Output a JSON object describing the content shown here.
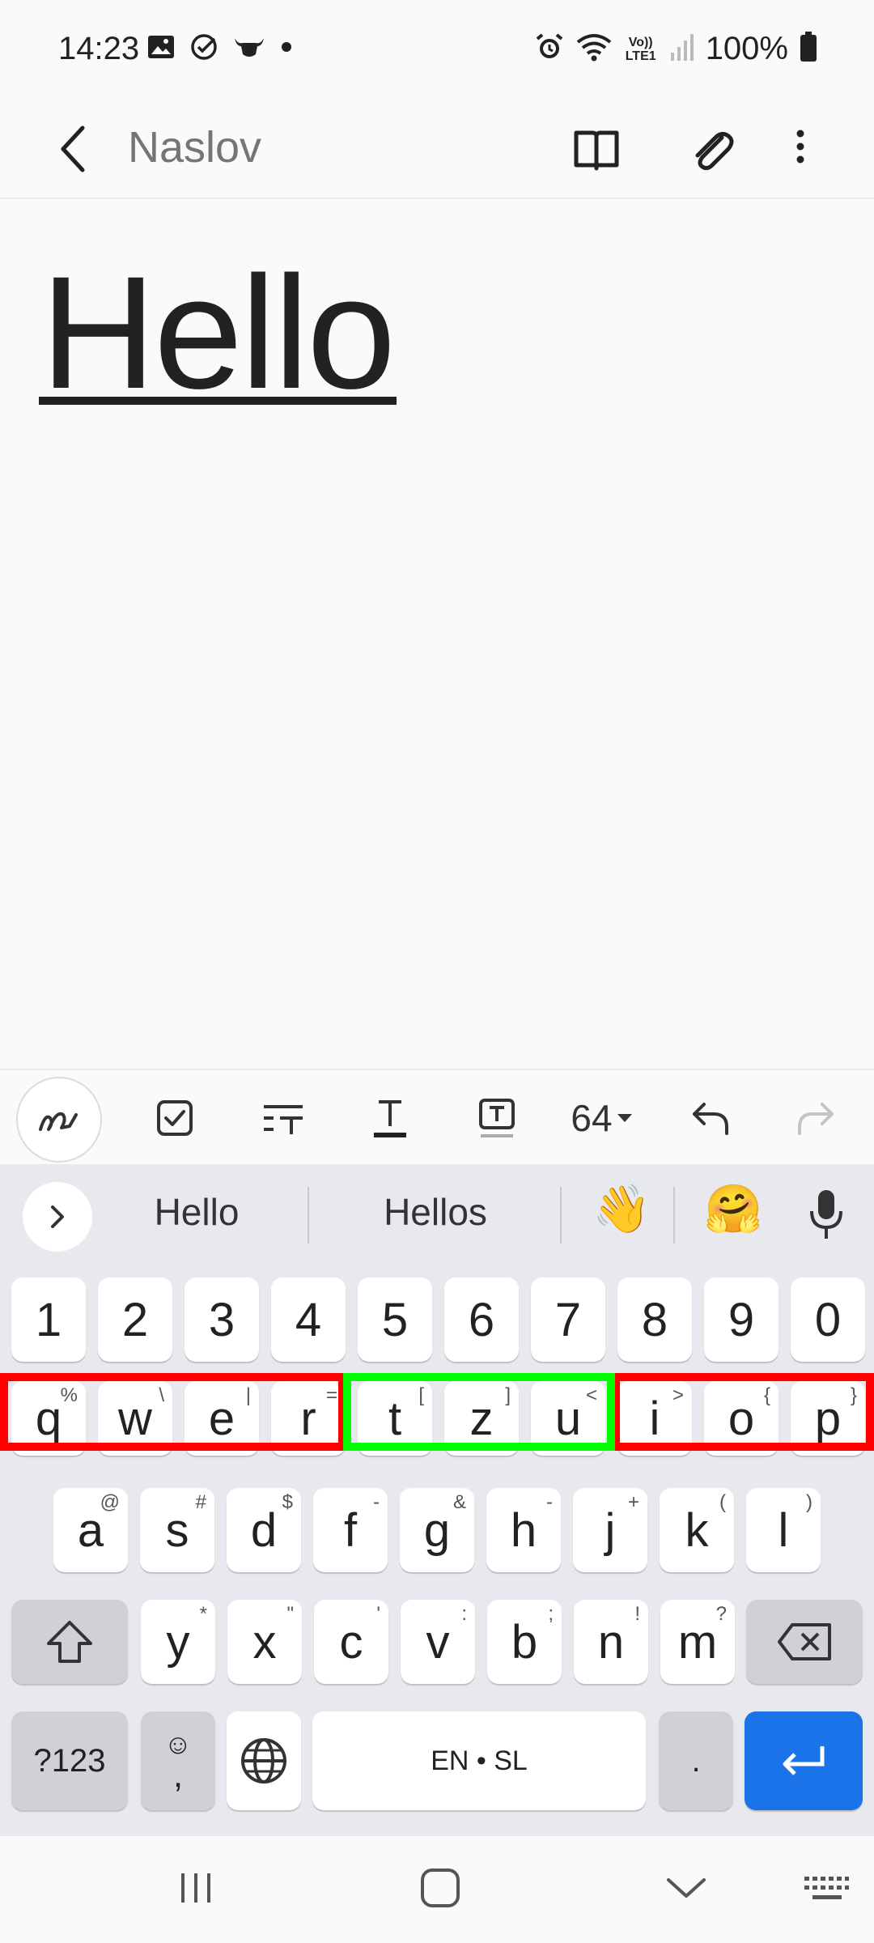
{
  "status_bar": {
    "time": "14:23",
    "left_icons": [
      "gallery-icon",
      "check-circle-icon",
      "bull-icon",
      "dot-icon"
    ],
    "right_icons": [
      "alarm-icon",
      "wifi-icon",
      "volte-icon",
      "signal-icon",
      "battery-icon"
    ],
    "volte_label": "Vo)) LTE1",
    "battery_percent": "100%"
  },
  "app_bar": {
    "title_placeholder": "Naslov",
    "icons": [
      "back-arrow-icon",
      "book-icon",
      "paperclip-icon",
      "more-vert-icon"
    ]
  },
  "editor": {
    "content": "Hello"
  },
  "toolbar": {
    "items": [
      "pen-icon",
      "checkbox-icon",
      "paragraph-style-icon",
      "text-color-icon",
      "text-box-icon",
      "font-size",
      "undo-icon",
      "redo-icon"
    ],
    "font_size": "64",
    "redo_enabled": false
  },
  "keyboard": {
    "suggestions": [
      "Hello",
      "Hellos"
    ],
    "suggestion_emojis": [
      "👋",
      "🤗"
    ],
    "number_row": [
      "1",
      "2",
      "3",
      "4",
      "5",
      "6",
      "7",
      "8",
      "9",
      "0"
    ],
    "row1": [
      {
        "key": "q",
        "hint": "%"
      },
      {
        "key": "w",
        "hint": "\\"
      },
      {
        "key": "e",
        "hint": "|"
      },
      {
        "key": "r",
        "hint": "="
      },
      {
        "key": "t",
        "hint": "["
      },
      {
        "key": "z",
        "hint": "]"
      },
      {
        "key": "u",
        "hint": "<"
      },
      {
        "key": "i",
        "hint": ">"
      },
      {
        "key": "o",
        "hint": "{"
      },
      {
        "key": "p",
        "hint": "}"
      }
    ],
    "row2": [
      {
        "key": "a",
        "hint": "@"
      },
      {
        "key": "s",
        "hint": "#"
      },
      {
        "key": "d",
        "hint": "$"
      },
      {
        "key": "f",
        "hint": "-"
      },
      {
        "key": "g",
        "hint": "&"
      },
      {
        "key": "h",
        "hint": "-"
      },
      {
        "key": "j",
        "hint": "+"
      },
      {
        "key": "k",
        "hint": "("
      },
      {
        "key": "l",
        "hint": ")"
      }
    ],
    "row3": [
      {
        "key": "y",
        "hint": "*"
      },
      {
        "key": "x",
        "hint": "\""
      },
      {
        "key": "c",
        "hint": "'"
      },
      {
        "key": "v",
        "hint": ":"
      },
      {
        "key": "b",
        "hint": ";"
      },
      {
        "key": "n",
        "hint": "!"
      },
      {
        "key": "m",
        "hint": "?"
      }
    ],
    "bottom": {
      "symbols_label": "?123",
      "emoji_comma_top": "☺",
      "emoji_comma_bottom": ",",
      "space_label": "EN • SL",
      "period_label": "."
    },
    "highlight_colors": {
      "red": "#ff0000",
      "green": "#00ff00"
    },
    "accent_color": "#1a73e8"
  },
  "nav_bar": {
    "icons": [
      "recent-apps-icon",
      "home-icon",
      "back-chevron-icon",
      "keyboard-icon"
    ]
  }
}
